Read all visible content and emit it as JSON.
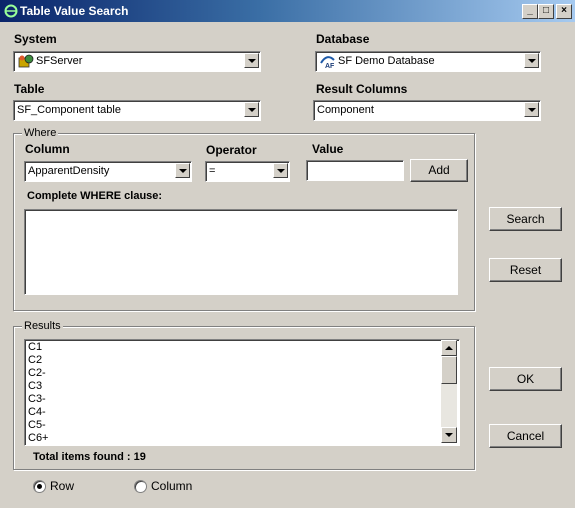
{
  "window": {
    "title": "Table Value Search",
    "min_glyph": "_",
    "max_glyph": "□",
    "close_glyph": "×"
  },
  "system": {
    "label": "System",
    "value": "SFServer",
    "icon": "server-icon"
  },
  "database": {
    "label": "Database",
    "value": "SF Demo Database",
    "icon": "database-icon"
  },
  "table": {
    "label": "Table",
    "value": "SF_Component table"
  },
  "result_columns": {
    "label": "Result Columns",
    "value": "Component"
  },
  "where": {
    "title": "Where",
    "column_label": "Column",
    "column_value": "ApparentDensity",
    "operator_label": "Operator",
    "operator_value": "=",
    "value_label": "Value",
    "value_input": "",
    "add_label": "Add",
    "complete_label": "Complete WHERE clause:",
    "clause_text": ""
  },
  "buttons": {
    "search": "Search",
    "reset": "Reset",
    "ok": "OK",
    "cancel": "Cancel"
  },
  "results": {
    "title": "Results",
    "items": [
      "C1",
      "C2",
      "C2-",
      "C3",
      "C3-",
      "C4-",
      "C5-",
      "C6+"
    ],
    "total_label": "Total items found : 19"
  },
  "mode": {
    "row_label": "Row",
    "column_label": "Column",
    "selected": "Row"
  }
}
